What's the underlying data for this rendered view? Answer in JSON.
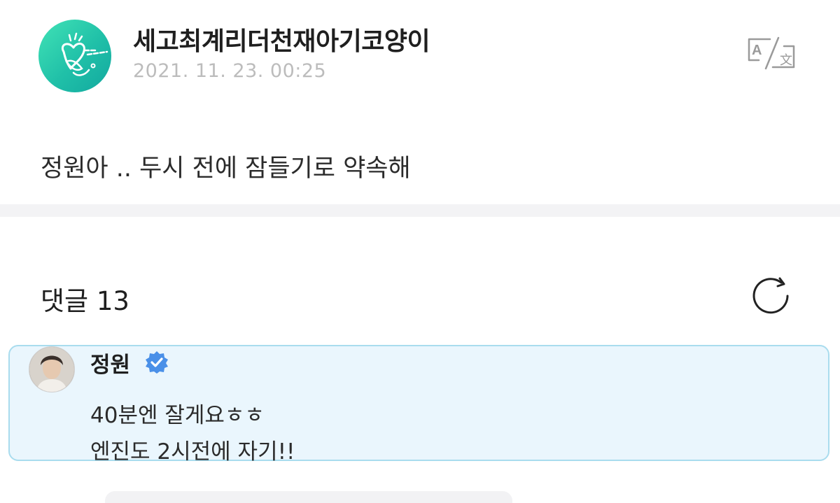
{
  "post": {
    "author_name": "세고최계리더천재아기코양이",
    "timestamp": "2021. 11. 23. 00:25",
    "body": "정원아 .. 두시 전에 잠들기로 약속해",
    "avatar_icon": "scribble-heart-avatar-icon",
    "translate_icon": "translate-icon",
    "translate_glyphs": {
      "latin": "A",
      "target": "文"
    }
  },
  "comments": {
    "title": "댓글 13",
    "refresh_icon": "refresh-icon",
    "items": [
      {
        "author": "정원",
        "verified_icon": "verified-badge-icon",
        "lines": [
          "40분엔 잘게요ㅎㅎ",
          "엔진도 2시전에 자기!!"
        ]
      }
    ]
  },
  "colors": {
    "avatar_gradient_start": "#41e3b6",
    "avatar_gradient_end": "#12a89f",
    "timestamp": "#bcbcbc",
    "divider": "#f3f3f5",
    "highlight_bg": "#eaf6fd",
    "highlight_border": "#a9dcee",
    "verified_blue": "#4a90e8"
  }
}
